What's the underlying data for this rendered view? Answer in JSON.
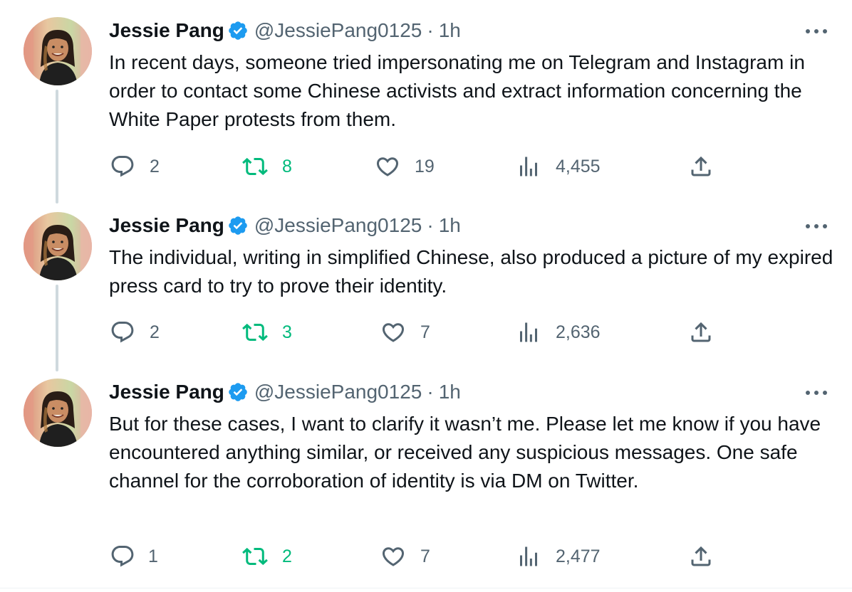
{
  "colors": {
    "text_primary": "#0f1419",
    "text_secondary": "#536471",
    "verified_blue": "#1d9bf0",
    "retweet_green": "#00ba7c",
    "thread_line": "#cfd9de"
  },
  "tweets": [
    {
      "author": {
        "name": "Jessie Pang",
        "handle": "@JessiePang0125",
        "verified_icon": "verified-badge-icon",
        "avatar": "avatar-photo"
      },
      "separator": "·",
      "time": "1h",
      "text": "In recent days, someone tried impersonating me on Telegram and Instagram in order to contact some Chinese activists and extract information concerning the White Paper protests from them.",
      "stats": {
        "replies": "2",
        "retweets": "8",
        "likes": "19",
        "views": "4,455"
      }
    },
    {
      "author": {
        "name": "Jessie Pang",
        "handle": "@JessiePang0125",
        "verified_icon": "verified-badge-icon",
        "avatar": "avatar-photo"
      },
      "separator": "·",
      "time": "1h",
      "text": "The individual, writing in simplified Chinese, also produced a picture of my expired press card to try to prove their identity.",
      "stats": {
        "replies": "2",
        "retweets": "3",
        "likes": "7",
        "views": "2,636"
      }
    },
    {
      "author": {
        "name": "Jessie Pang",
        "handle": "@JessiePang0125",
        "verified_icon": "verified-badge-icon",
        "avatar": "avatar-photo"
      },
      "separator": "·",
      "time": "1h",
      "text": "But for these cases, I want to clarify it wasn’t me. Please let me know if you have encountered anything similar, or received any suspicious messages. One safe channel for the corroboration of identity is via DM on Twitter.",
      "stats": {
        "replies": "1",
        "retweets": "2",
        "likes": "7",
        "views": "2,477"
      }
    }
  ],
  "icons": {
    "more": "more-dots-icon",
    "reply": "reply-icon",
    "retweet": "retweet-icon",
    "like": "heart-icon",
    "views": "views-chart-icon",
    "share": "share-icon"
  }
}
